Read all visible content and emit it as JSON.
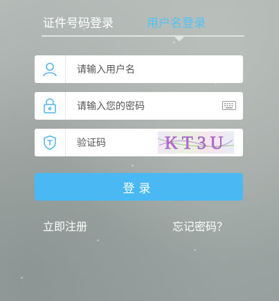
{
  "tabs": {
    "phone_label": "证件号码登录",
    "username_label": "用户名登录",
    "active": "username_label"
  },
  "form": {
    "username_placeholder": "请输入用户名",
    "password_placeholder": "请输入您的密码",
    "captcha_placeholder": "验证码",
    "captcha_text": "KT3U"
  },
  "icons": {
    "username": "user-icon",
    "password": "lock-icon",
    "captcha": "shield-icon",
    "keyboard": "keyboard-icon"
  },
  "buttons": {
    "login_label": "登录"
  },
  "links": {
    "register": "立即注册",
    "forgot_password": "忘记密码？"
  },
  "colors": {
    "accent": "#4ab8f3",
    "active_tab": "#4fc3f7",
    "icon": "#4fb3ea"
  }
}
